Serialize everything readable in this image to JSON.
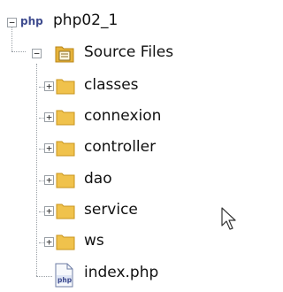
{
  "project": {
    "badge": "php",
    "name": "php02_1"
  },
  "source_files": {
    "label": "Source Files"
  },
  "folders": [
    {
      "label": "classes"
    },
    {
      "label": "connexion"
    },
    {
      "label": "controller"
    },
    {
      "label": "dao"
    },
    {
      "label": "service"
    },
    {
      "label": "ws"
    }
  ],
  "files": [
    {
      "label": "index.php",
      "badge": "php"
    }
  ]
}
